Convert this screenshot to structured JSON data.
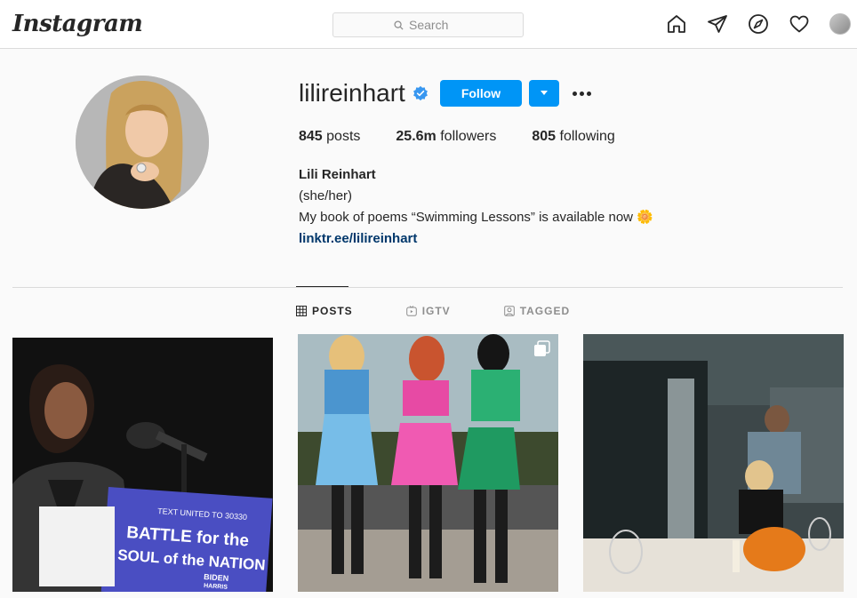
{
  "nav": {
    "logo": "Instagram",
    "search_placeholder": "Search",
    "icons": [
      "home-icon",
      "direct-message-icon",
      "explore-icon",
      "activity-heart-icon",
      "profile-avatar"
    ]
  },
  "profile": {
    "username": "lilireinhart",
    "verified": true,
    "follow_label": "Follow",
    "stats": {
      "posts_count": "845",
      "posts_label": "posts",
      "followers_count": "25.6m",
      "followers_label": "followers",
      "following_count": "805",
      "following_label": "following"
    },
    "bio": {
      "name": "Lili Reinhart",
      "pronouns": "(she/her)",
      "text": "My book of poems “Swimming Lessons” is available now 🌼",
      "link": "linktr.ee/lilireinhart"
    }
  },
  "tabs": [
    {
      "label": "POSTS",
      "active": true
    },
    {
      "label": "IGTV",
      "active": false
    },
    {
      "label": "TAGGED",
      "active": false
    }
  ],
  "posts": {
    "post1": {
      "sign_line1": "TEXT UNITED TO 30330",
      "sign_line2": "BATTLE for the",
      "sign_line3": "SOUL of the NATION",
      "sign_logo1": "BIDEN",
      "sign_logo2": "HARRIS"
    }
  },
  "colors": {
    "accent": "#0095f6",
    "link": "#00376b",
    "text": "#262626",
    "muted": "#8e8e8e",
    "border": "#dbdbdb"
  }
}
